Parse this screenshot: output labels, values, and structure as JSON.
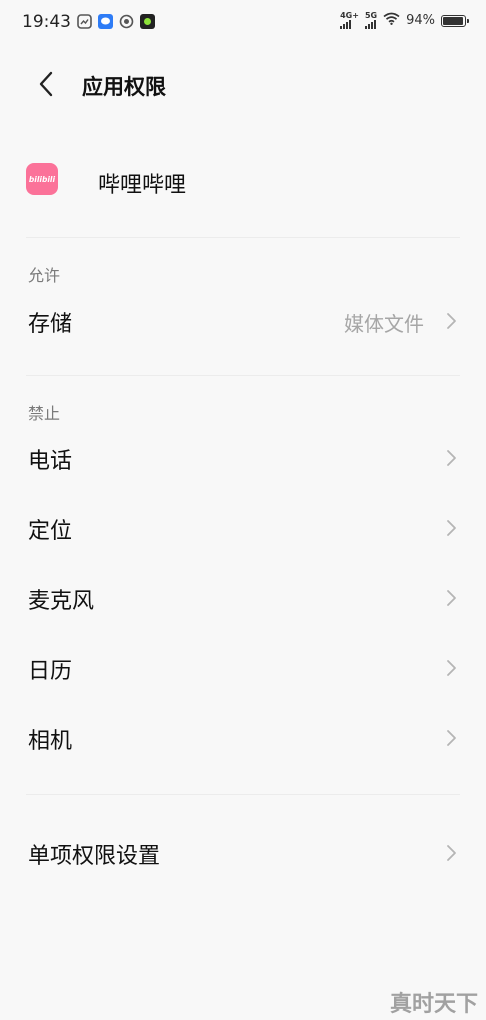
{
  "status_bar": {
    "time": "19:43",
    "signal1_label": "4G+",
    "signal2_label": "5G",
    "battery_percent": "94%",
    "battery_level": 0.94
  },
  "header": {
    "title": "应用权限"
  },
  "app": {
    "name": "哔哩哔哩",
    "icon_text": "bilibili",
    "icon_color": "#fb7299"
  },
  "sections": {
    "allowed_label": "允许",
    "denied_label": "禁止"
  },
  "allowed": [
    {
      "label": "存储",
      "value": "媒体文件"
    }
  ],
  "denied": [
    {
      "label": "电话"
    },
    {
      "label": "定位"
    },
    {
      "label": "麦克风"
    },
    {
      "label": "日历"
    },
    {
      "label": "相机"
    }
  ],
  "single_permission": {
    "label": "单项权限设置"
  },
  "watermark": "真时天下",
  "colors": {
    "background": "#f8f8f8",
    "text": "#111111",
    "secondary_text": "#7a7a7a",
    "value_text": "#a6a6a6"
  }
}
